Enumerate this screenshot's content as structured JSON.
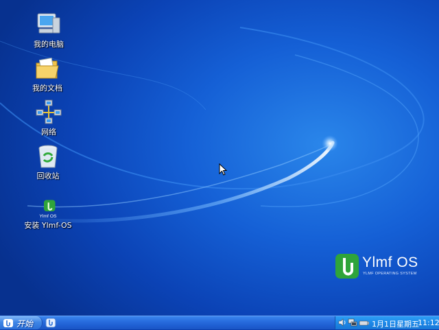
{
  "desktop": {
    "icons": [
      {
        "label": "我的电脑",
        "icon": "my-computer-icon"
      },
      {
        "label": "我的文档",
        "icon": "my-documents-icon"
      },
      {
        "label": "网络",
        "icon": "network-icon"
      },
      {
        "label": "回收站",
        "icon": "recycle-bin-icon"
      },
      {
        "label": "安装 Ylmf-OS",
        "icon": "ylmf-installer-icon",
        "icon_text": "Ylmf OS"
      }
    ],
    "brand": {
      "title": "Ylmf OS",
      "subtitle": "YLMF OPERATING SYSTEM"
    }
  },
  "taskbar": {
    "start_label": "开始",
    "quick_launch": [
      "show-desktop-icon"
    ],
    "tray": {
      "icons": [
        "volume-icon",
        "network-status-icon",
        "usb-device-icon"
      ],
      "date": "1月1日星期五",
      "time": "11:12"
    }
  },
  "colors": {
    "desktop_blue": "#1560d6",
    "taskbar_blue": "#2a6fe0",
    "tray_blue": "#1d88e8",
    "brand_green": "#2fa43a"
  }
}
